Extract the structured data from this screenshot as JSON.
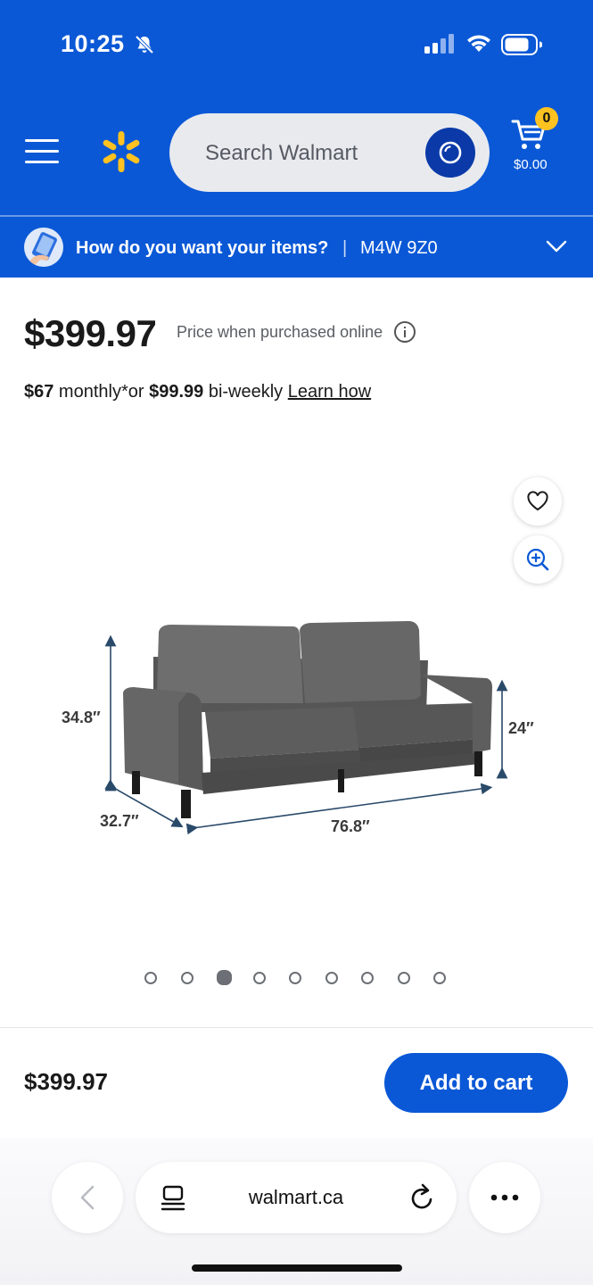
{
  "status_bar": {
    "time": "10:25"
  },
  "header": {
    "search_placeholder": "Search Walmart",
    "cart_count": "0",
    "cart_total": "$0.00"
  },
  "delivery": {
    "prompt": "How do you want your items?",
    "separator": "|",
    "postal_code": "M4W 9Z0"
  },
  "product": {
    "price": "$399.97",
    "price_note": "Price when purchased online",
    "financing": {
      "monthly_amount": "$67",
      "monthly_text": " monthly*or ",
      "biweekly_amount": "$99.99",
      "biweekly_text": " bi-weekly ",
      "learn_link": "Learn how"
    },
    "dimensions": {
      "height": "34.8″",
      "arm_height": "24″",
      "depth": "32.7″",
      "width": "76.8″"
    },
    "image_count": 9,
    "active_image_index": 2
  },
  "sticky": {
    "price": "$399.97",
    "add_to_cart": "Add to cart"
  },
  "browser": {
    "url": "walmart.ca"
  },
  "colors": {
    "walmart_blue": "#0a58d6",
    "spark_yellow": "#ffc220",
    "search_button_blue": "#0b3aa8"
  }
}
